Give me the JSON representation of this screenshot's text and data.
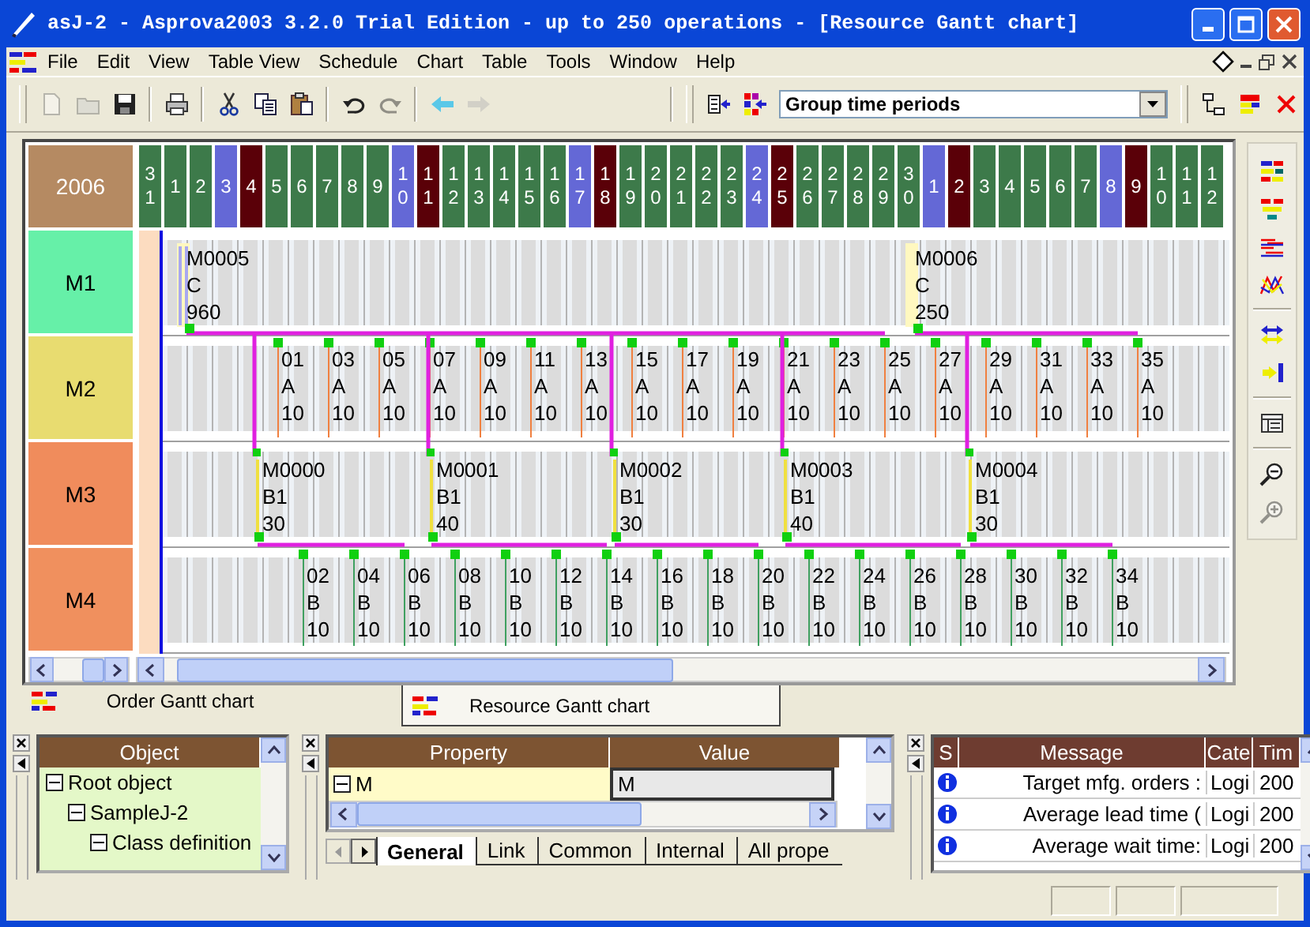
{
  "window": {
    "title": "asJ-2 - Asprova2003 3.2.0 Trial Edition  - up to 250 operations - [Resource Gantt chart]"
  },
  "menu": [
    "File",
    "Edit",
    "View",
    "Table View",
    "Schedule",
    "Chart",
    "Table",
    "Tools",
    "Window",
    "Help"
  ],
  "toolbar": [
    {
      "kind": "new",
      "disabled": true
    },
    {
      "kind": "open",
      "disabled": true
    },
    {
      "kind": "save",
      "disabled": false
    },
    {
      "kind": "print",
      "disabled": false
    },
    {
      "kind": "cut",
      "disabled": false
    },
    {
      "kind": "copy",
      "disabled": false
    },
    {
      "kind": "paste",
      "disabled": false
    },
    {
      "kind": "undo",
      "disabled": false
    },
    {
      "kind": "redo",
      "disabled": true
    },
    {
      "kind": "back",
      "disabled": false
    },
    {
      "kind": "forward",
      "disabled": true
    }
  ],
  "group_select": {
    "value": "Group time periods"
  },
  "toolbar_right": [
    {
      "kind": "tree",
      "disabled": false
    },
    {
      "kind": "bars",
      "disabled": false
    },
    {
      "kind": "close",
      "disabled": false
    }
  ],
  "side_toolbar": [
    {
      "kind": "order-gantt",
      "disabled": false
    },
    {
      "kind": "resource-gantt",
      "disabled": false
    },
    {
      "kind": "lines",
      "disabled": false
    },
    {
      "kind": "chart",
      "disabled": false
    },
    {
      "kind": "swap",
      "disabled": false
    },
    {
      "kind": "arrow-bar",
      "disabled": false
    },
    {
      "kind": "table",
      "disabled": false
    },
    {
      "kind": "zoom-out",
      "disabled": false
    },
    {
      "kind": "zoom-in",
      "disabled": true
    }
  ],
  "gantt": {
    "year": "2006",
    "days": [
      {
        "label": "31",
        "kind": "weekday"
      },
      {
        "label": "1",
        "kind": "weekday"
      },
      {
        "label": "2",
        "kind": "weekday"
      },
      {
        "label": "3",
        "kind": "saturday"
      },
      {
        "label": "4",
        "kind": "sunday"
      },
      {
        "label": "5",
        "kind": "weekday"
      },
      {
        "label": "6",
        "kind": "weekday"
      },
      {
        "label": "7",
        "kind": "weekday"
      },
      {
        "label": "8",
        "kind": "weekday"
      },
      {
        "label": "9",
        "kind": "weekday"
      },
      {
        "label": "10",
        "kind": "saturday"
      },
      {
        "label": "11",
        "kind": "sunday"
      },
      {
        "label": "12",
        "kind": "weekday"
      },
      {
        "label": "13",
        "kind": "weekday"
      },
      {
        "label": "14",
        "kind": "weekday"
      },
      {
        "label": "15",
        "kind": "weekday"
      },
      {
        "label": "16",
        "kind": "weekday"
      },
      {
        "label": "17",
        "kind": "saturday"
      },
      {
        "label": "18",
        "kind": "sunday"
      },
      {
        "label": "19",
        "kind": "weekday"
      },
      {
        "label": "20",
        "kind": "weekday"
      },
      {
        "label": "21",
        "kind": "weekday"
      },
      {
        "label": "22",
        "kind": "weekday"
      },
      {
        "label": "23",
        "kind": "weekday"
      },
      {
        "label": "24",
        "kind": "saturday"
      },
      {
        "label": "25",
        "kind": "sunday"
      },
      {
        "label": "26",
        "kind": "weekday"
      },
      {
        "label": "27",
        "kind": "weekday"
      },
      {
        "label": "28",
        "kind": "weekday"
      },
      {
        "label": "29",
        "kind": "weekday"
      },
      {
        "label": "30",
        "kind": "weekday"
      },
      {
        "label": "1",
        "kind": "saturday"
      },
      {
        "label": "2",
        "kind": "sunday"
      },
      {
        "label": "3",
        "kind": "weekday"
      },
      {
        "label": "4",
        "kind": "weekday"
      },
      {
        "label": "5",
        "kind": "weekday"
      },
      {
        "label": "6",
        "kind": "weekday"
      },
      {
        "label": "7",
        "kind": "weekday"
      },
      {
        "label": "8",
        "kind": "saturday"
      },
      {
        "label": "9",
        "kind": "sunday"
      },
      {
        "label": "10",
        "kind": "weekday"
      },
      {
        "label": "11",
        "kind": "weekday"
      },
      {
        "label": "12",
        "kind": "weekday"
      }
    ],
    "resources": [
      {
        "name": "M1",
        "color": "#66f0a8",
        "operations": [
          {
            "lines": [
              "M0005",
              "C",
              "960"
            ]
          },
          {
            "lines": [
              "M0006",
              "C",
              "250"
            ]
          }
        ]
      },
      {
        "name": "M2",
        "color": "#e8dc70",
        "operations": [
          {
            "lines": [
              "01",
              "A",
              "10"
            ]
          },
          {
            "lines": [
              "03",
              "A",
              "10"
            ]
          },
          {
            "lines": [
              "05",
              "A",
              "10"
            ]
          },
          {
            "lines": [
              "07",
              "A",
              "10"
            ]
          },
          {
            "lines": [
              "09",
              "A",
              "10"
            ]
          },
          {
            "lines": [
              "11",
              "A",
              "10"
            ]
          },
          {
            "lines": [
              "13",
              "A",
              "10"
            ]
          },
          {
            "lines": [
              "15",
              "A",
              "10"
            ]
          },
          {
            "lines": [
              "17",
              "A",
              "10"
            ]
          },
          {
            "lines": [
              "19",
              "A",
              "10"
            ]
          },
          {
            "lines": [
              "21",
              "A",
              "10"
            ]
          },
          {
            "lines": [
              "23",
              "A",
              "10"
            ]
          },
          {
            "lines": [
              "25",
              "A",
              "10"
            ]
          },
          {
            "lines": [
              "27",
              "A",
              "10"
            ]
          },
          {
            "lines": [
              "29",
              "A",
              "10"
            ]
          },
          {
            "lines": [
              "31",
              "A",
              "10"
            ]
          },
          {
            "lines": [
              "33",
              "A",
              "10"
            ]
          },
          {
            "lines": [
              "35",
              "A",
              "10"
            ]
          }
        ]
      },
      {
        "name": "M3",
        "color": "#f08c5c",
        "operations": [
          {
            "lines": [
              "M0000",
              "B1",
              "30"
            ]
          },
          {
            "lines": [
              "M0001",
              "B1",
              "40"
            ]
          },
          {
            "lines": [
              "M0002",
              "B1",
              "30"
            ]
          },
          {
            "lines": [
              "M0003",
              "B1",
              "40"
            ]
          },
          {
            "lines": [
              "M0004",
              "B1",
              "30"
            ]
          }
        ]
      },
      {
        "name": "M4",
        "color": "#f0905e",
        "operations": [
          {
            "lines": [
              "02",
              "B",
              "10"
            ]
          },
          {
            "lines": [
              "04",
              "B",
              "10"
            ]
          },
          {
            "lines": [
              "06",
              "B",
              "10"
            ]
          },
          {
            "lines": [
              "08",
              "B",
              "10"
            ]
          },
          {
            "lines": [
              "10",
              "B",
              "10"
            ]
          },
          {
            "lines": [
              "12",
              "B",
              "10"
            ]
          },
          {
            "lines": [
              "14",
              "B",
              "10"
            ]
          },
          {
            "lines": [
              "16",
              "B",
              "10"
            ]
          },
          {
            "lines": [
              "18",
              "B",
              "10"
            ]
          },
          {
            "lines": [
              "20",
              "B",
              "10"
            ]
          },
          {
            "lines": [
              "22",
              "B",
              "10"
            ]
          },
          {
            "lines": [
              "24",
              "B",
              "10"
            ]
          },
          {
            "lines": [
              "26",
              "B",
              "10"
            ]
          },
          {
            "lines": [
              "28",
              "B",
              "10"
            ]
          },
          {
            "lines": [
              "30",
              "B",
              "10"
            ]
          },
          {
            "lines": [
              "32",
              "B",
              "10"
            ]
          },
          {
            "lines": [
              "34",
              "B",
              "10"
            ]
          }
        ]
      }
    ]
  },
  "tabs": [
    {
      "label": "Order Gantt chart",
      "selected": false
    },
    {
      "label": "Resource Gantt chart",
      "selected": true
    }
  ],
  "object_tree": {
    "header": "Object",
    "items": [
      {
        "label": "Root object",
        "expanded": true,
        "children": [
          {
            "label": "SampleJ-2",
            "expanded": true,
            "children": [
              {
                "label": "Class definition",
                "expanded": true
              }
            ]
          }
        ]
      }
    ]
  },
  "property_table": {
    "columns": [
      "Property",
      "Value"
    ],
    "rows": [
      {
        "property": "M",
        "expanded": true,
        "value": "M"
      }
    ],
    "tabs": [
      {
        "label": "General",
        "selected": true
      },
      {
        "label": "Link",
        "selected": false
      },
      {
        "label": "Common",
        "selected": false
      },
      {
        "label": "Internal",
        "selected": false
      },
      {
        "label": "All prope",
        "selected": false
      }
    ]
  },
  "messages": {
    "columns": [
      "S",
      "Message",
      "Cate",
      "Tim"
    ],
    "rows": [
      {
        "message": "Target mfg. orders :",
        "category": "Logi",
        "time": "200"
      },
      {
        "message": "Average lead time (",
        "category": "Logi",
        "time": "200"
      },
      {
        "message": "Average wait time:",
        "category": "Logi",
        "time": "200"
      }
    ]
  }
}
